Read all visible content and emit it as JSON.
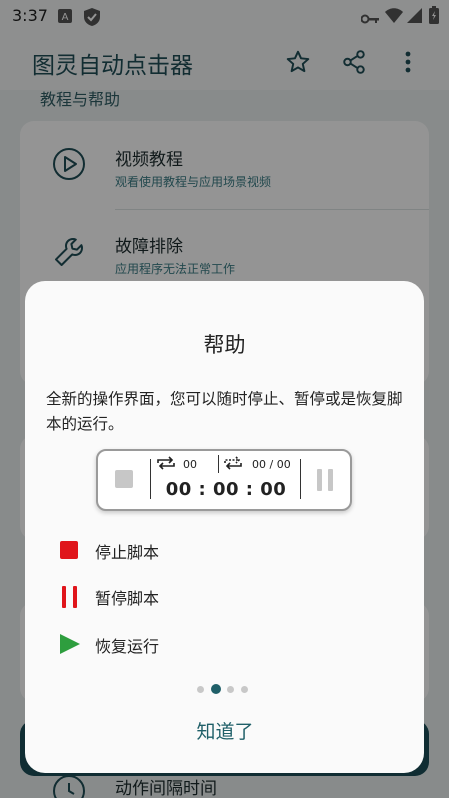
{
  "status_bar": {
    "time": "3:37"
  },
  "app_bar": {
    "title": "图灵自动点击器",
    "icons": [
      "star-icon",
      "share-icon",
      "more-vert-icon"
    ]
  },
  "background": {
    "section_title": "教程与帮助",
    "items": [
      {
        "title": "视频教程",
        "subtitle": "观看使用教程与应用场景视频",
        "icon": "play-circle-icon"
      },
      {
        "title": "故障排除",
        "subtitle": "应用程序无法正常工作",
        "icon": "wrench-icon"
      }
    ],
    "bottom_item": {
      "title": "动作间隔时间",
      "icon": "clock-icon"
    }
  },
  "dialog": {
    "title": "帮助",
    "description": "全新的操作界面，您可以随时停止、暂停或是恢复脚本的运行。",
    "control": {
      "loop_count": "00",
      "loop_progress": "00 / 00",
      "timer": "00 : 00 : 00"
    },
    "legend": [
      {
        "label": "停止脚本",
        "icon": "stop-icon"
      },
      {
        "label": "暂停脚本",
        "icon": "pause-icon"
      },
      {
        "label": "恢复运行",
        "icon": "play-icon"
      }
    ],
    "page_indicator": {
      "count": 4,
      "active": 2
    },
    "ok_label": "知道了"
  },
  "colors": {
    "accent": "#1f5f68",
    "stop": "#e0151b",
    "pause": "#e0151b",
    "play": "#2e9e3e"
  }
}
